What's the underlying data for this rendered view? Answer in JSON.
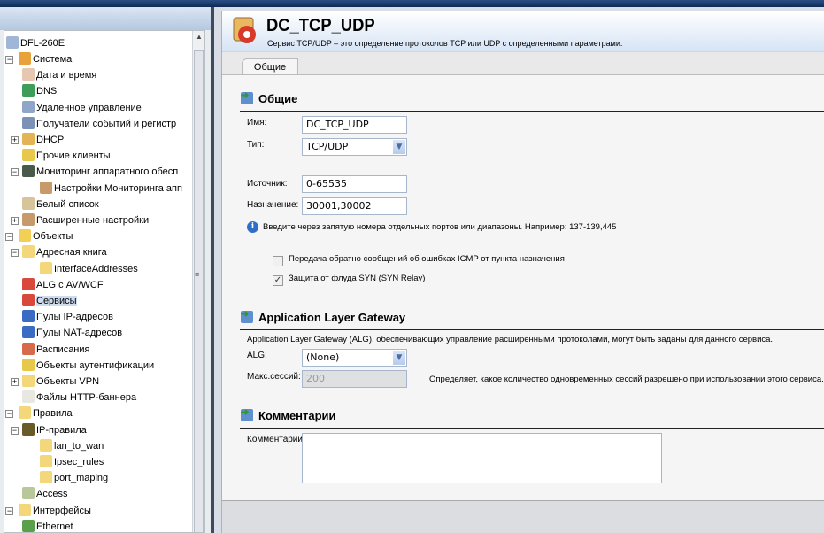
{
  "tree": {
    "root": "DFL-260E",
    "items": [
      {
        "label": "Система",
        "level": 0,
        "expander": "-",
        "color": "#e7a23a"
      },
      {
        "label": "Дата и время",
        "level": 1,
        "color": "#e7c7b0"
      },
      {
        "label": "DNS",
        "level": 1,
        "color": "#3f9d5a"
      },
      {
        "label": "Удаленное управление",
        "level": 1,
        "color": "#8fa6c9"
      },
      {
        "label": "Получатели событий и регистр",
        "level": 1,
        "color": "#7c90b8"
      },
      {
        "label": "DHCP",
        "level": 1,
        "expander": "+",
        "color": "#e3b454"
      },
      {
        "label": "Прочие клиенты",
        "level": 1,
        "color": "#e8c84a"
      },
      {
        "label": "Мониторинг аппаратного обесп",
        "level": 1,
        "expander": "-",
        "color": "#4a5a4a"
      },
      {
        "label": "Настройки Мониторинга апп",
        "level": 2,
        "color": "#c89a6a"
      },
      {
        "label": "Белый список",
        "level": 1,
        "color": "#d7c49a"
      },
      {
        "label": "Расширенные настройки",
        "level": 1,
        "expander": "+",
        "color": "#c89a6a"
      },
      {
        "label": "Объекты",
        "level": 0,
        "expander": "-",
        "color": "#f3cf55"
      },
      {
        "label": "Адресная книга",
        "level": 1,
        "expander": "-",
        "color": "#f3d77a"
      },
      {
        "label": "InterfaceAddresses",
        "level": 2,
        "color": "#f3d77a"
      },
      {
        "label": "ALG с AV/WCF",
        "level": 1,
        "color": "#d9483a"
      },
      {
        "label": "Сервисы",
        "level": 1,
        "color": "#d9483a",
        "selected": true
      },
      {
        "label": "Пулы IP-адресов",
        "level": 1,
        "color": "#3b6cc4"
      },
      {
        "label": "Пулы NAT-адресов",
        "level": 1,
        "color": "#3b6cc4"
      },
      {
        "label": "Расписания",
        "level": 1,
        "color": "#d76a4a"
      },
      {
        "label": "Объекты аутентификации",
        "level": 1,
        "color": "#e8c84a"
      },
      {
        "label": "Объекты VPN",
        "level": 1,
        "expander": "+",
        "color": "#f3d77a"
      },
      {
        "label": "Файлы HTTP-баннера",
        "level": 1,
        "color": "#e8e8e0"
      },
      {
        "label": "Правила",
        "level": 0,
        "expander": "-",
        "color": "#f3d77a"
      },
      {
        "label": "IP-правила",
        "level": 1,
        "expander": "-",
        "color": "#6a5a2a"
      },
      {
        "label": "lan_to_wan",
        "level": 2,
        "color": "#f3d77a"
      },
      {
        "label": "Ipsec_rules",
        "level": 2,
        "color": "#f3d77a"
      },
      {
        "label": "port_maping",
        "level": 2,
        "color": "#f3d77a"
      },
      {
        "label": "Access",
        "level": 1,
        "color": "#b8c89a"
      },
      {
        "label": "Интерфейсы",
        "level": 0,
        "expander": "-",
        "color": "#f3d77a"
      },
      {
        "label": "Ethernet",
        "level": 1,
        "color": "#5aa04a"
      }
    ]
  },
  "header": {
    "title": "DC_TCP_UDP",
    "subtitle": "Сервис TCP/UDP – это определение протоколов TCP или UDP с определенными параметрами."
  },
  "tabs": [
    {
      "label": "Общие",
      "active": true
    }
  ],
  "general": {
    "heading": "Общие",
    "name_label": "Имя:",
    "name_value": "DC_TCP_UDP",
    "type_label": "Тип:",
    "type_value": "TCP/UDP",
    "source_label": "Источник:",
    "source_value": "0-65535",
    "dest_label": "Назначение:",
    "dest_value": "30001,30002",
    "hint": "Введите через запятую номера отдельных портов или диапазоны. Например: 137-139,445",
    "icmp_label": "Передача обратно сообщений об ошибках ICMP от пункта назначения",
    "icmp_checked": false,
    "syn_label": "Защита от флуда SYN (SYN Relay)",
    "syn_checked": true
  },
  "alg": {
    "heading": "Application Layer Gateway",
    "description": "Application Layer Gateway (ALG), обеспечивающих управление расширенными протоколами, могут быть заданы для данного сервиса.",
    "alg_label": "ALG:",
    "alg_value": "(None)",
    "max_label": "Макс.сессий:",
    "max_value": "200",
    "max_hint": "Определяет, какое количество одновременных сессий разрешено при использовании этого сервиса."
  },
  "comments": {
    "heading": "Комментарии",
    "label": "Комментарии:",
    "value": ""
  }
}
